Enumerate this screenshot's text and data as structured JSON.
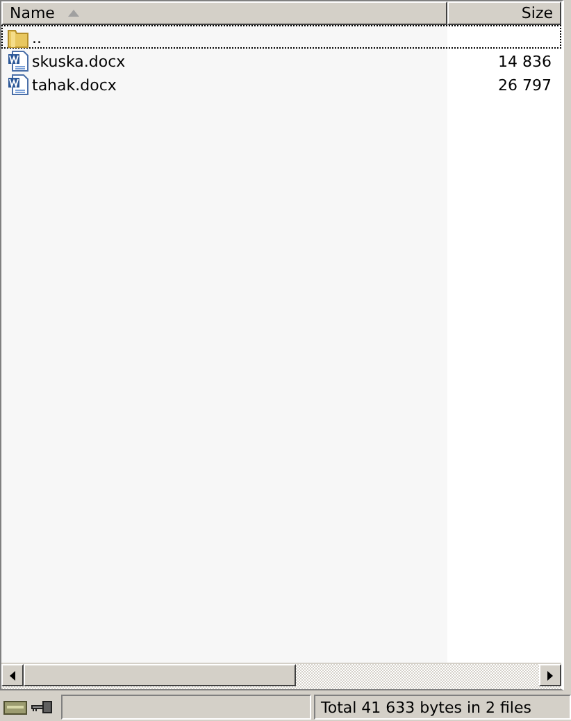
{
  "columns": [
    {
      "label": "Name",
      "sorted": true
    },
    {
      "label": "Size",
      "sorted": false
    }
  ],
  "rows": [
    {
      "kind": "folder",
      "name": "..",
      "size": "",
      "selected": true
    },
    {
      "kind": "doc",
      "name": "skuska.docx",
      "size": "14 836",
      "selected": false
    },
    {
      "kind": "doc",
      "name": "tahak.docx",
      "size": "26 797",
      "selected": false
    }
  ],
  "status_bar": {
    "text": "Total 41 633 bytes in 2 files"
  }
}
